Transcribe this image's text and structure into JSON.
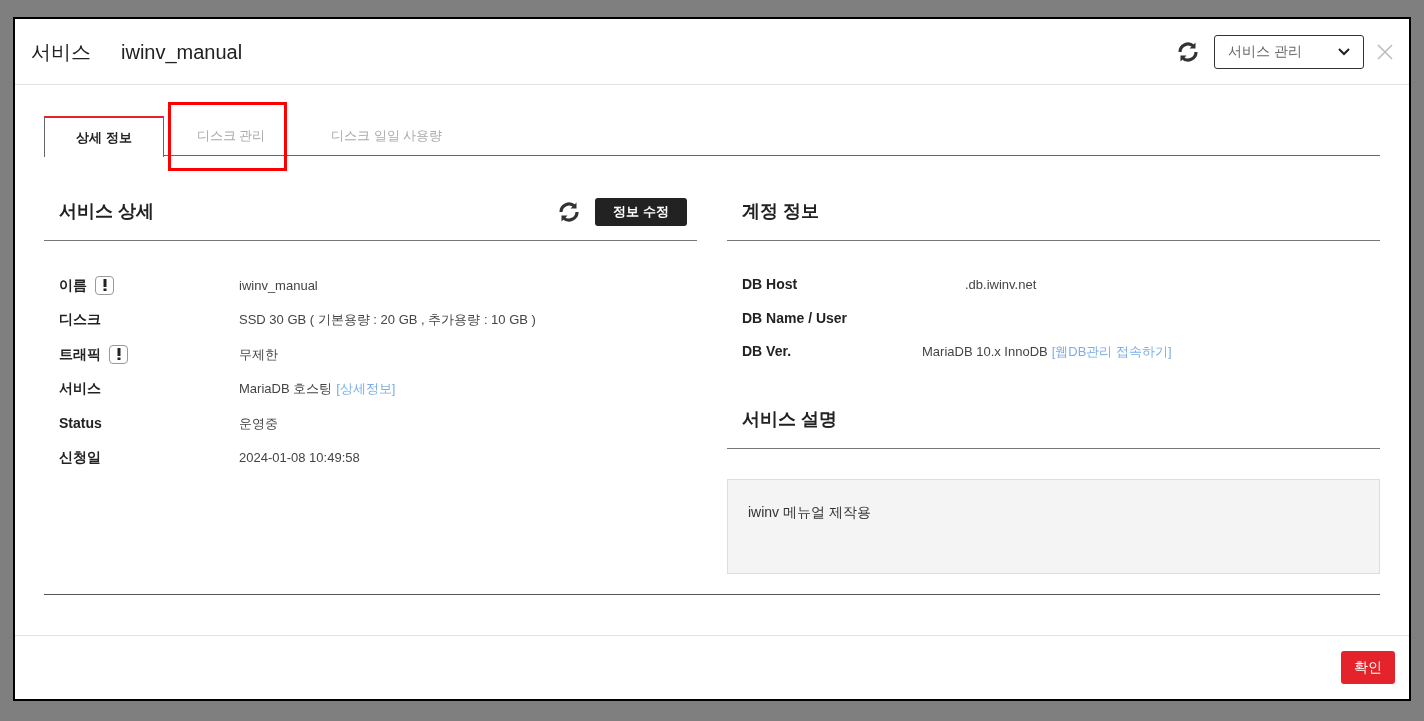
{
  "modal": {
    "title_label": "서비스",
    "title_name": "iwinv_manual",
    "menu_select": {
      "value": "서비스 관리"
    }
  },
  "tabs": [
    {
      "label": "상세 정보",
      "selected": true,
      "highlighted": false
    },
    {
      "label": "디스크 관리",
      "selected": false,
      "highlighted": true
    },
    {
      "label": "디스크 일일 사용량",
      "selected": false,
      "highlighted": false
    }
  ],
  "service_detail": {
    "title": "서비스 상세",
    "edit_button": "정보 수정",
    "rows": [
      {
        "label": "이름",
        "info": true,
        "value": "iwinv_manual"
      },
      {
        "label": "디스크",
        "info": false,
        "value": "SSD 30 GB ( 기본용량 : 20 GB , 추가용량 : 10 GB )"
      },
      {
        "label": "트래픽",
        "info": true,
        "value": "무제한"
      },
      {
        "label": "서비스",
        "info": false,
        "value": "MariaDB 호스팅",
        "link": "[상세정보]"
      },
      {
        "label": "Status",
        "info": false,
        "value": "운영중"
      },
      {
        "label": "신청일",
        "info": false,
        "value": "2024-01-08 10:49:58"
      }
    ]
  },
  "account_info": {
    "title": "계정 정보",
    "rows": [
      {
        "label": "DB Host",
        "value": ".db.iwinv.net",
        "kind": "host"
      },
      {
        "label": "DB Name / User",
        "kind": "plain"
      },
      {
        "label": "DB Ver.",
        "value": "MariaDB 10.x InnoDB",
        "link": "[웹DB관리 접속하기]",
        "kind": "plain"
      }
    ]
  },
  "service_description": {
    "title": "서비스 설명",
    "text": "iwinv 메뉴얼 제작용"
  },
  "footer": {
    "confirm_button": "확인"
  }
}
